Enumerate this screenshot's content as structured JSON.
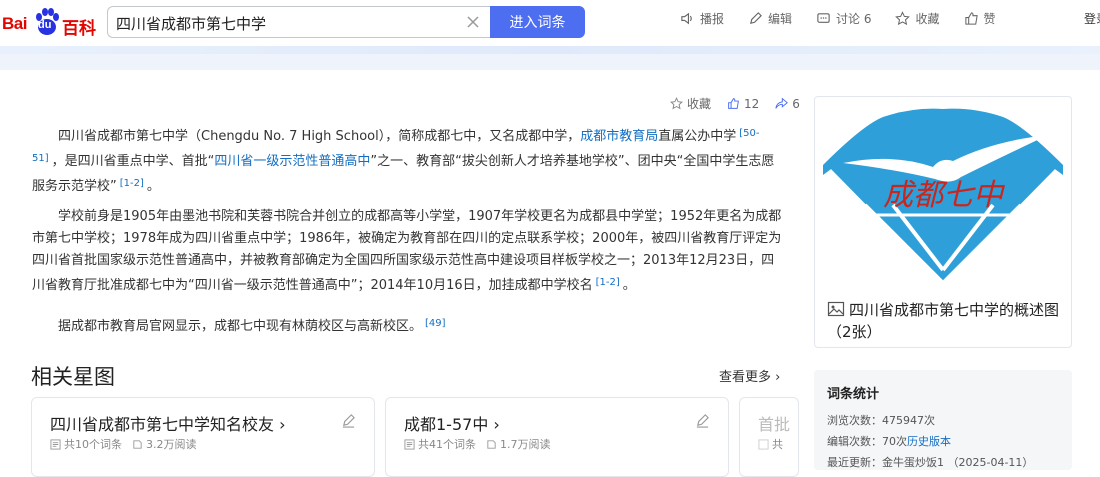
{
  "header": {
    "logo_text_bai": "Bai",
    "logo_text_du": "du",
    "logo_text_baike": "百科",
    "search_value": "四川省成都市第七中学",
    "search_button": "进入词条",
    "actions": [
      {
        "icon": "speaker-icon",
        "label": "播报"
      },
      {
        "icon": "pencil-icon",
        "label": "编辑"
      },
      {
        "icon": "comment-icon",
        "label": "讨论 6"
      },
      {
        "icon": "star-icon",
        "label": "收藏"
      },
      {
        "icon": "thumbs-up-icon",
        "label": "赞"
      }
    ],
    "login": "登录"
  },
  "article_stats": {
    "favorite": "收藏",
    "likes": "12",
    "shares": "6"
  },
  "paragraphs": {
    "p1": {
      "t1": "四川省成都市第七中学（Chengdu No. 7 High School），简称成都七中，又名成都中学，",
      "link1": "成都市教育局",
      "t2": "直属公办中学",
      "ref1": "[50-51]",
      "t3": "，是四川省重点中学、首批“",
      "link2": "四川省一级示范性普通高中",
      "t4": "”之一、教育部“拔尖创新人才培养基地学校”、团中央“全国中学生志愿服务示范学校”",
      "ref2": "[1-2]",
      "t5": "。"
    },
    "p2": {
      "text": "学校前身是1905年由墨池书院和芙蓉书院合并创立的成都高等小学堂，1907年学校更名为成都县中学堂；1952年更名为成都市第七中学校；1978年成为四川省重点中学；1986年，被确定为教育部在四川的定点联系学校；2000年，被四川省教育厅评定为四川省首批国家级示范性普通高中，并被教育部确定为全国四所国家级示范性高中建设项目样板学校之一；2013年12月23日，四川省教育厅批准成都七中为“四川省一级示范性普通高中”；2014年10月16日，加挂成都中学校名",
      "ref": "[1-2]",
      "end": "。"
    },
    "p3": {
      "text": "据成都市教育局官网显示，成都七中现有林荫校区与高新校区。",
      "ref": "[49]"
    }
  },
  "related": {
    "title": "相关星图",
    "see_more": "查看更多",
    "cards": [
      {
        "title": "四川省成都市第七中学知名校友",
        "entries": "共10个词条",
        "reads": "3.2万阅读"
      },
      {
        "title": "成都1-57中",
        "entries": "共41个词条",
        "reads": "1.7万阅读"
      },
      {
        "title": "首批",
        "entries": "共",
        "reads": ""
      }
    ]
  },
  "sidebar": {
    "album_caption": "四川省成都市第七中学的概述图（2张）",
    "logo_chars": "成都七中",
    "stats_title": "词条统计",
    "views_label": "浏览次数：",
    "views": "475947次",
    "edits_label": "编辑次数：",
    "edits": "70次",
    "history": "历史版本",
    "updated_label": "最近更新：",
    "updated": "金牛蛋炒饭1 （2025-04-11）"
  },
  "colors": {
    "accent": "#4e6ef2",
    "link": "#136ec2",
    "logo_red": "#e10601",
    "logo_blue": "#2e9fd8"
  }
}
